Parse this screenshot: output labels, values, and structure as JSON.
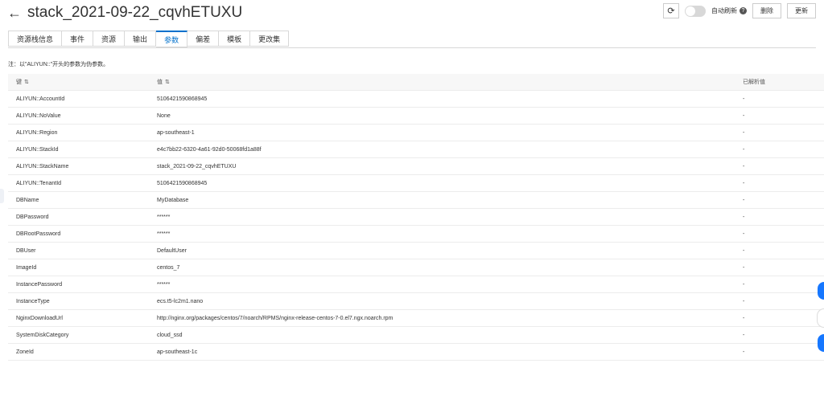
{
  "header": {
    "title": "stack_2021-09-22_cqvhETUXU",
    "refresh_icon": "refresh-icon",
    "auto_refresh_label": "自动刷新",
    "help_icon": "help-icon",
    "delete_label": "删除",
    "update_label": "更新"
  },
  "tabs": [
    {
      "label": "资源栈信息"
    },
    {
      "label": "事件"
    },
    {
      "label": "资源"
    },
    {
      "label": "输出"
    },
    {
      "label": "参数"
    },
    {
      "label": "偏差"
    },
    {
      "label": "模板"
    },
    {
      "label": "更改集"
    }
  ],
  "note": "注：以\"ALIYUN::\"开头的参数为伪参数。",
  "table": {
    "headers": {
      "key": "键",
      "value": "值",
      "resolved": "已解析值"
    },
    "rows": [
      {
        "key": "ALIYUN::AccountId",
        "value": "5106421590868945",
        "resolved": "-"
      },
      {
        "key": "ALIYUN::NoValue",
        "value": "None",
        "resolved": "-"
      },
      {
        "key": "ALIYUN::Region",
        "value": "ap-southeast-1",
        "resolved": "-"
      },
      {
        "key": "ALIYUN::StackId",
        "value": "e4c7bb22-6320-4a61-92d0-50068fd1a88f",
        "resolved": "-"
      },
      {
        "key": "ALIYUN::StackName",
        "value": "stack_2021-09-22_cqvhETUXU",
        "resolved": "-"
      },
      {
        "key": "ALIYUN::TenantId",
        "value": "5106421590868945",
        "resolved": "-"
      },
      {
        "key": "DBName",
        "value": "MyDatabase",
        "resolved": "-"
      },
      {
        "key": "DBPassword",
        "value": "******",
        "resolved": "-"
      },
      {
        "key": "DBRootPassword",
        "value": "******",
        "resolved": "-"
      },
      {
        "key": "DBUser",
        "value": "DefaultUser",
        "resolved": "-"
      },
      {
        "key": "ImageId",
        "value": "centos_7",
        "resolved": "-"
      },
      {
        "key": "InstancePassword",
        "value": "******",
        "resolved": "-"
      },
      {
        "key": "InstanceType",
        "value": "ecs.t5-lc2m1.nano",
        "resolved": "-"
      },
      {
        "key": "NginxDownloadUrl",
        "value": "http://nginx.org/packages/centos/7/noarch/RPMS/nginx-release-centos-7-0.el7.ngx.noarch.rpm",
        "resolved": "-"
      },
      {
        "key": "SystemDiskCategory",
        "value": "cloud_ssd",
        "resolved": "-"
      },
      {
        "key": "ZoneId",
        "value": "ap-southeast-1c",
        "resolved": "-"
      }
    ]
  },
  "colors": {
    "accent": "#0070cc",
    "float_blue": "#1677ff"
  }
}
